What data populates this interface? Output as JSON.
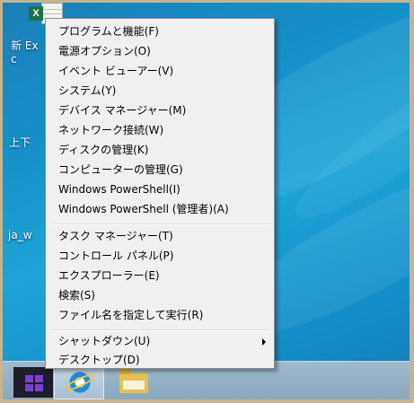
{
  "desktop": {
    "icons": [
      {
        "name": "新 Exc"
      },
      {
        "name": "上下"
      },
      {
        "name": "ja_w"
      }
    ]
  },
  "menu": {
    "group1": [
      {
        "label": "プログラムと機能(F)"
      },
      {
        "label": "電源オプション(O)"
      },
      {
        "label": "イベント ビューアー(V)"
      },
      {
        "label": "システム(Y)"
      },
      {
        "label": "デバイス マネージャー(M)"
      },
      {
        "label": "ネットワーク接続(W)"
      },
      {
        "label": "ディスクの管理(K)"
      },
      {
        "label": "コンピューターの管理(G)"
      },
      {
        "label": "Windows PowerShell(I)"
      },
      {
        "label": "Windows PowerShell (管理者)(A)"
      }
    ],
    "group2": [
      {
        "label": "タスク マネージャー(T)"
      },
      {
        "label": "コントロール パネル(P)"
      },
      {
        "label": "エクスプローラー(E)"
      },
      {
        "label": "検索(S)"
      },
      {
        "label": "ファイル名を指定して実行(R)"
      }
    ],
    "group3": [
      {
        "label": "シャットダウン(U)",
        "submenu": true
      },
      {
        "label": "デスクトップ(D)"
      }
    ]
  },
  "taskbar": {
    "items": [
      {
        "icon": "windows-logo-icon"
      },
      {
        "icon": "internet-explorer-icon"
      },
      {
        "icon": "file-explorer-icon"
      }
    ]
  }
}
